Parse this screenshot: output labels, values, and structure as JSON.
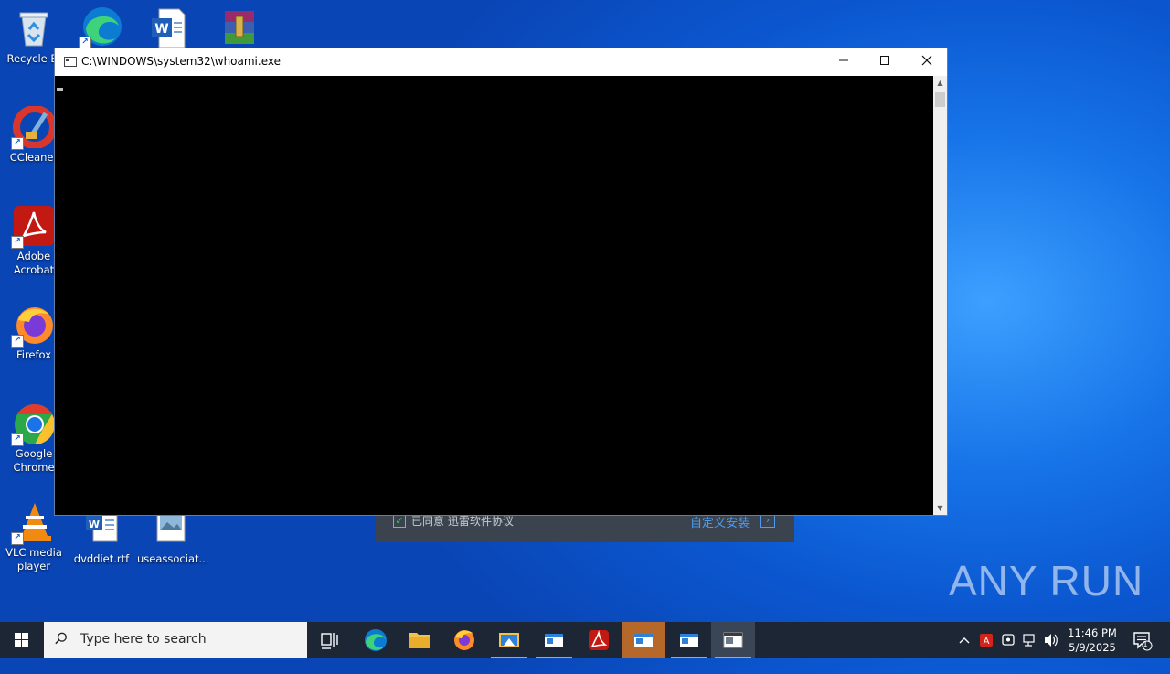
{
  "desktop": {
    "icons": [
      {
        "label": "Recycle Bin",
        "display": "Recycle Bi"
      },
      {
        "label": "CCleaner"
      },
      {
        "label": "Adobe Acrobat",
        "line1": "Adobe",
        "line2": "Acrobat"
      },
      {
        "label": "Firefox"
      },
      {
        "label": "Google Chrome",
        "line1": "Google",
        "line2": "Chrome"
      },
      {
        "label": "VLC media player",
        "line1": "VLC media",
        "line2": "player"
      },
      {
        "label": "dvddiet.rtf"
      },
      {
        "label": "useassociat..."
      }
    ]
  },
  "installer": {
    "agree_text": "已同意 迅雷软件协议",
    "custom_install": "自定义安装",
    "agree_checked": true
  },
  "window": {
    "title": "C:\\WINDOWS\\system32\\whoami.exe",
    "minimize": "—",
    "maximize": "☐",
    "close": "✕"
  },
  "taskbar": {
    "search_placeholder": "Type here to search",
    "clock_time": "11:46 PM",
    "clock_date": "5/9/2025",
    "notification_count": "1"
  },
  "watermark": "ANY RUN",
  "colors": {
    "desktop_accent": "#1774e8",
    "taskbar": "#1c2634",
    "console_bg": "#000000",
    "highlight_task": "#b5682a"
  }
}
